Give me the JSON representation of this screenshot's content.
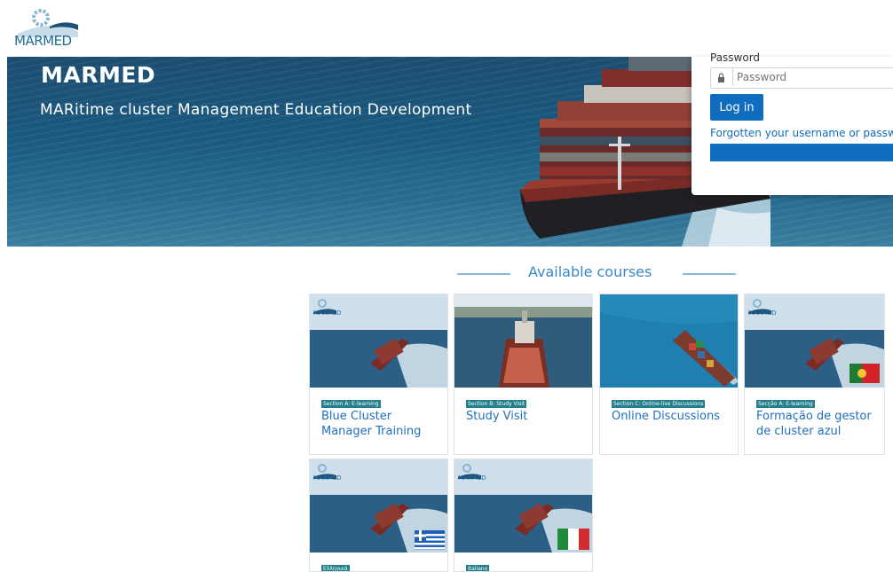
{
  "site": {
    "logo_text": "MARMED"
  },
  "hero": {
    "title": "MARMED",
    "subtitle": "MARitime cluster Management Education Development"
  },
  "login": {
    "password_label": "Password",
    "password_placeholder": "Password",
    "login_button": "Log in",
    "forgot_link": "Forgotten your username or password?"
  },
  "courses": {
    "heading": "Available courses",
    "items": [
      {
        "tag": "Section A: E-learning",
        "title": "Blue Cluster Manager Training",
        "image": "ship-logo",
        "flag": ""
      },
      {
        "tag": "Section B: Study Visit",
        "title": "Study Visit",
        "image": "tug-boat",
        "flag": ""
      },
      {
        "tag": "Section C: Online-live Discussions",
        "title": "Online Discussions",
        "image": "aerial-ship",
        "flag": ""
      },
      {
        "tag": "Secção A: E-learning",
        "title": "Formação de gestor de cluster azul",
        "image": "ship-logo",
        "flag": "portugal-flag"
      },
      {
        "tag": "Ελληνικά",
        "title": "",
        "image": "ship-logo",
        "flag": "greece-flag"
      },
      {
        "tag": "Italiano",
        "title": "",
        "image": "ship-logo",
        "flag": "italy-flag"
      }
    ]
  },
  "colors": {
    "brand_blue": "#0f6cbf",
    "tag_teal": "#247f8c",
    "heading_blue": "#3a86c6"
  }
}
